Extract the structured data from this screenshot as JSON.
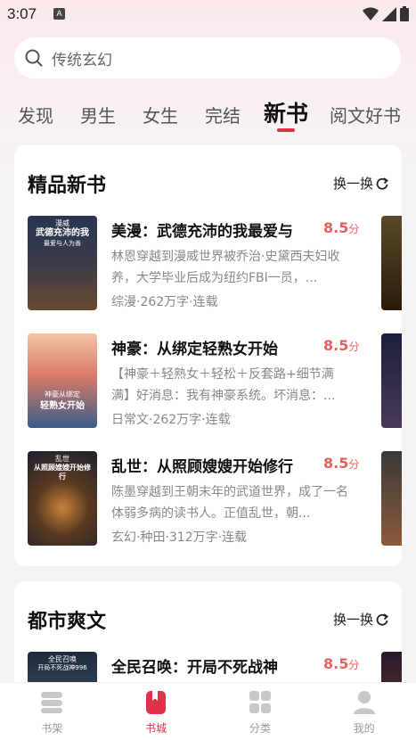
{
  "status_bar": {
    "time": "3:07",
    "notification_badge": "A"
  },
  "search": {
    "placeholder": "传统玄幻"
  },
  "tabs": [
    {
      "label": "发现"
    },
    {
      "label": "男生"
    },
    {
      "label": "女生"
    },
    {
      "label": "完结"
    },
    {
      "label": "新书",
      "active": true
    },
    {
      "label": "阅文好书"
    }
  ],
  "sections": [
    {
      "title": "精品新书",
      "refresh_label": "换一换",
      "books": [
        {
          "title": "美漫：武德充沛的我最爱与",
          "score": "8.5",
          "score_unit": "分",
          "desc": "林恩穿越到漫威世界被乔治·史黛西夫妇收养，大学毕业后成为纽约FBI一员，...",
          "meta": "综漫·262万字·连载",
          "cover": {
            "lines": [
              "漫威",
              "武德充沛的我",
              "最爱与人为善"
            ],
            "colors": [
              "#2a3550",
              "#6a4a2e"
            ]
          }
        },
        {
          "title": "神豪：从绑定轻熟女开始",
          "score": "8.5",
          "score_unit": "分",
          "desc": "【神豪＋轻熟女＋轻松＋反套路+细节满满】好消息：我有神豪系统。坏消息：...",
          "meta": "日常文·262万字·连载",
          "cover": {
            "lines": [
              "神豪从绑定",
              "轻熟女开始"
            ],
            "colors": [
              "#f0b89a",
              "#3b5d8a"
            ]
          }
        },
        {
          "title": "乱世：从照顾嫂嫂开始修行",
          "score": "8.5",
          "score_unit": "分",
          "desc": "陈墨穿越到王朝末年的武道世界，成了一名体弱多病的读书人。正值乱世，朝...",
          "meta": "玄幻·种田·312万字·连载",
          "cover": {
            "lines": [
              "乱世",
              "从照顾嫂嫂开始修行"
            ],
            "colors": [
              "#1a1f2e",
              "#8a5a2a"
            ]
          }
        }
      ]
    },
    {
      "title": "都市爽文",
      "refresh_label": "换一换",
      "books": [
        {
          "title": "全民召唤：开局不死战神",
          "score": "8.5",
          "score_unit": "分",
          "cover": {
            "lines": [
              "全民召唤",
              "开局不死战神996"
            ],
            "colors": [
              "#1f2b3d",
              "#4a5f7a"
            ]
          }
        }
      ]
    }
  ],
  "bottom_nav": [
    {
      "label": "书架",
      "icon": "bookshelf-icon"
    },
    {
      "label": "书城",
      "icon": "bookstore-icon",
      "active": true
    },
    {
      "label": "分类",
      "icon": "category-icon"
    },
    {
      "label": "我的",
      "icon": "profile-icon"
    }
  ],
  "colors": {
    "accent": "#e0314b",
    "score": "#e8615d"
  }
}
